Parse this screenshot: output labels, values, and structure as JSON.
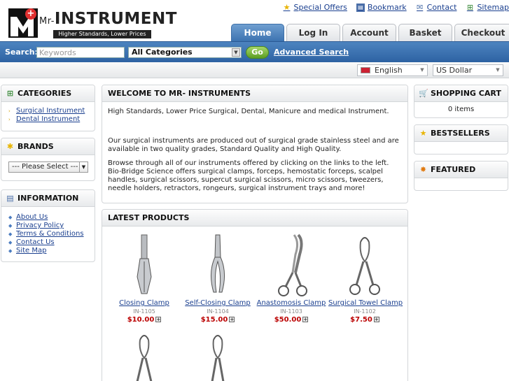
{
  "header": {
    "logo_prefix": "Mr-",
    "logo_name": "INSTRUMENT",
    "logo_tagline": "Higher Standards, Lower Prices",
    "top_links": [
      {
        "label": "Special Offers",
        "icon": "star-icon"
      },
      {
        "label": "Bookmark",
        "icon": "bookmark-icon"
      },
      {
        "label": "Contact",
        "icon": "envelope-icon"
      },
      {
        "label": "Sitemap",
        "icon": "sitemap-icon"
      }
    ],
    "tabs": [
      "Home",
      "Log In",
      "Account",
      "Basket",
      "Checkout"
    ],
    "active_tab": "Home"
  },
  "search": {
    "label": "Search:",
    "placeholder": "Keywords",
    "category": "All Categories",
    "go_label": "Go",
    "advanced_label": "Advanced Search"
  },
  "locale": {
    "language": "English",
    "currency": "US Dollar"
  },
  "sidebar_left": {
    "categories_title": "CATEGORIES",
    "categories": [
      "Surgical Instrument",
      "Dental Instrument"
    ],
    "brands_title": "BRANDS",
    "brands_select": "--- Please Select ---",
    "information_title": "INFORMATION",
    "information": [
      "About Us",
      "Privacy Policy",
      "Terms & Conditions",
      "Contact Us",
      "Site Map"
    ]
  },
  "welcome": {
    "title": "WELCOME TO MR- INSTRUMENTS",
    "p1": "High Standards, Lower Price Surgical, Dental, Manicure and medical Instrument.",
    "p2": "Our surgical instruments are produced out of surgical grade stainless steel and are available in two quality grades, Standard Quality and High Quality.",
    "p3": "Browse through all of our instruments offered by clicking on the links to the left. Bio-Bridge Science offers surgical clamps, forceps, hemostatic forceps, scalpel handles, surgical scissors, supercut surgical scissors, micro scissors, tweezers, needle holders, retractors, rongeurs, surgical instrument trays and more!"
  },
  "latest": {
    "title": "LATEST PRODUCTS",
    "products": [
      {
        "name": "Closing Clamp",
        "model": "IN-1105",
        "price": "$10.00"
      },
      {
        "name": "Self-Closing Clamp",
        "model": "IN-1104",
        "price": "$15.00"
      },
      {
        "name": "Anastomosis Clamp",
        "model": "IN-1103",
        "price": "$50.00"
      },
      {
        "name": "Surgical Towel Clamp",
        "model": "IN-1102",
        "price": "$7.50"
      }
    ]
  },
  "sidebar_right": {
    "cart_title": "SHOPPING CART",
    "cart_text": "0 items",
    "best_title": "BESTSELLERS",
    "featured_title": "FEATURED"
  },
  "colors": {
    "accent": "#3d73b1",
    "go_button": "#6aab2c",
    "price": "#bb0000"
  }
}
